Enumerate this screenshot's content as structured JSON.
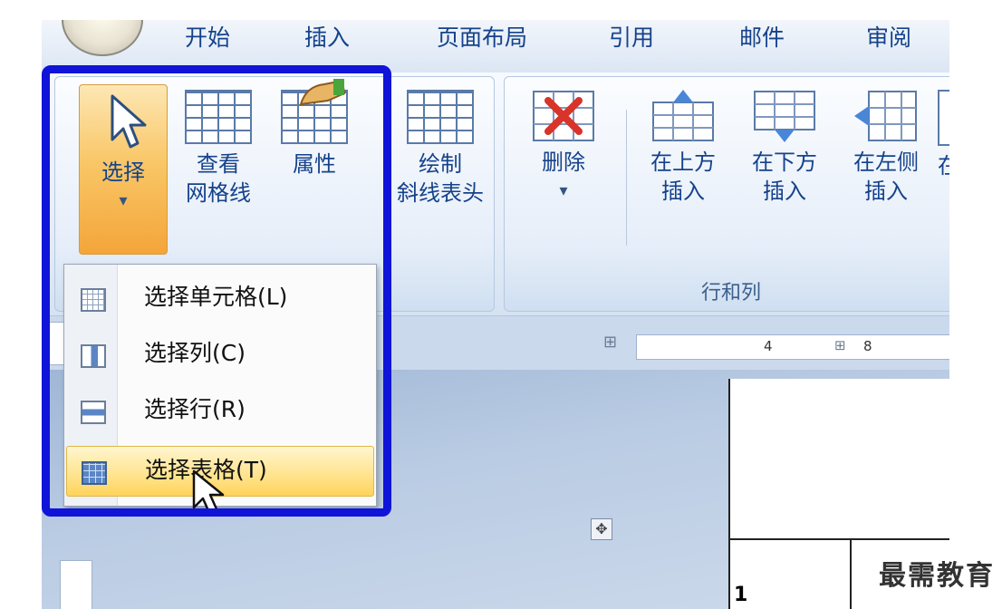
{
  "tabs": [
    "开始",
    "插入",
    "页面布局",
    "引用",
    "邮件",
    "审阅"
  ],
  "ribbon": {
    "select": {
      "label": "选择",
      "arrow": "▾"
    },
    "view_gridlines": {
      "line1": "查看",
      "line2": "网格线"
    },
    "properties": {
      "label": "属性"
    },
    "draw_diagonal": {
      "line1": "绘制",
      "line2": "斜线表头"
    },
    "delete": {
      "label": "删除",
      "arrow": "▾"
    },
    "insert_above": {
      "line1": "在上方",
      "line2": "插入"
    },
    "insert_below": {
      "line1": "在下方",
      "line2": "插入"
    },
    "insert_left": {
      "line1": "在左侧",
      "line2": "插入"
    },
    "insert_right_partial": {
      "line1": "在"
    },
    "group_rows_cols": "行和列"
  },
  "ruler": {
    "mark1": "4",
    "mark2": "8"
  },
  "select_menu": {
    "items": [
      {
        "label": "选择单元格(L)",
        "icon": "select-cell-icon"
      },
      {
        "label": "选择列(C)",
        "icon": "select-column-icon"
      },
      {
        "label": "选择行(R)",
        "icon": "select-row-icon"
      },
      {
        "label": "选择表格(T)",
        "icon": "select-table-icon",
        "highlighted": true
      }
    ]
  },
  "doc": {
    "cell_text": "1"
  },
  "watermark": "最需教育",
  "colors": {
    "highlight_border": "#0f14d8",
    "menu_hover": "#ffe38c",
    "tab_text": "#15428b"
  }
}
